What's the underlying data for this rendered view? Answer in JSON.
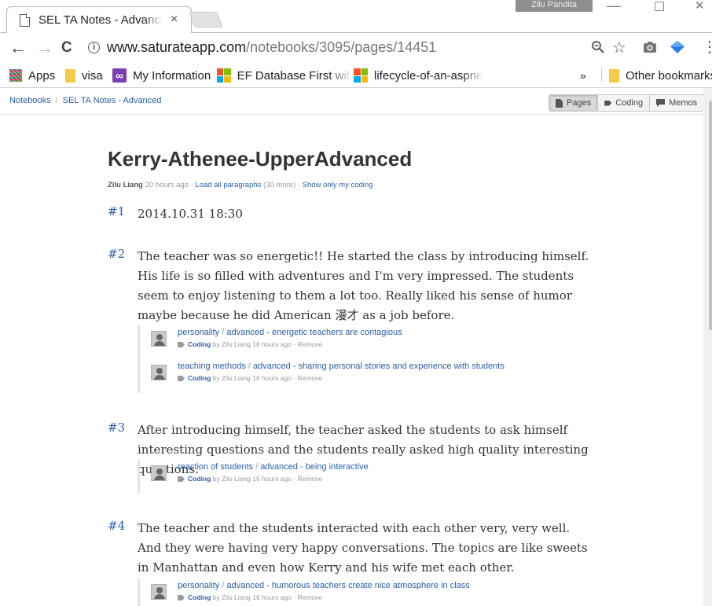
{
  "browser": {
    "tab_title": "SEL TA Notes - Advanced",
    "tab_close": "×",
    "profile_name": "Zilu Pandita",
    "win_min": "—",
    "win_max": "☐",
    "win_close": "✕",
    "back": "←",
    "forward": "→",
    "reload": "C",
    "url_host": "www.saturateapp.com",
    "url_path": "/notebooks/3095/pages/14451",
    "menu": "⋮"
  },
  "bookmarks": {
    "apps": "Apps",
    "visa": "visa",
    "my_information": "My Information",
    "ef_database": "EF Database First with",
    "lifecycle": "lifecycle-of-an-aspnet",
    "overflow": "»",
    "other": "Other bookmarks"
  },
  "breadcrumb": {
    "notebooks": "Notebooks",
    "sep": "/",
    "current": "SEL TA Notes - Advanced"
  },
  "view_tabs": {
    "pages": "Pages",
    "coding": "Coding",
    "memos": "Memos"
  },
  "page": {
    "title": "Kerry-Athenee-UpperAdvanced",
    "author": "Zilu Liang",
    "time": "20 hours ago",
    "dot": "·",
    "load_all": "Load all paragraphs",
    "more_count": "(30 more)",
    "show_mine": "Show only my coding"
  },
  "paragraphs": [
    {
      "num": "#1",
      "text": "2014.10.31 18:30",
      "codings": []
    },
    {
      "num": "#2",
      "text": "The teacher was so energetic!! He started the class by introducing himself. His life is so filled with adventures and I'm very impressed. The students seem to enjoy listening to them a lot too. Really liked his sense of humor maybe because he did American 漫才 as a job before.",
      "codings": [
        {
          "category": "personality",
          "slash": " / ",
          "code": "advanced - energetic teachers are contagious",
          "label": "Coding",
          "by": "by Zilu Liang",
          "time": "16 hours ago",
          "dot": "·",
          "remove": "Remove"
        },
        {
          "category": "teaching methods",
          "slash": " / ",
          "code": "advanced - sharing personal stories and experience with students",
          "label": "Coding",
          "by": "by Zilu Liang",
          "time": "16 hours ago",
          "dot": "·",
          "remove": "Remove"
        }
      ]
    },
    {
      "num": "#3",
      "text": "After introducing himself, the teacher asked the students to ask himself interesting questions and the students really asked high quality interesting questions.",
      "codings": [
        {
          "category": "reaction of students",
          "slash": " / ",
          "code": "advanced - being interactive",
          "label": "Coding",
          "by": "by Zilu Liang",
          "time": "16 hours ago",
          "dot": "·",
          "remove": "Remove"
        }
      ]
    },
    {
      "num": "#4",
      "text": "The teacher and the students interacted with each other very, very well. And they were having very happy conversations. The topics are like sweets in Manhattan and even how Kerry and his wife met each other.",
      "codings": [
        {
          "category": "personality",
          "slash": " / ",
          "code": "advanced - humorous teachers create nice atmosphere in class",
          "label": "Coding",
          "by": "by Zilu Liang",
          "time": "16 hours ago",
          "dot": "·",
          "remove": "Remove"
        }
      ]
    }
  ]
}
